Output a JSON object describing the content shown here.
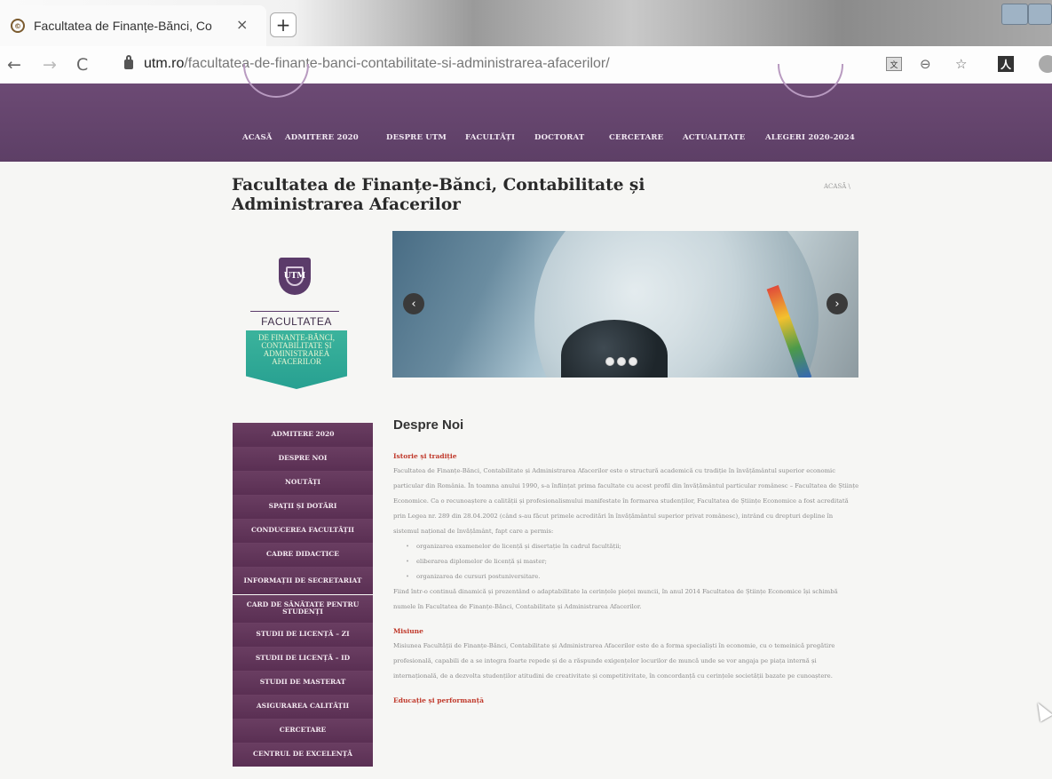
{
  "browser": {
    "tab_title": "Facultatea de Finanțe-Bănci, Co",
    "tab_favicon": "©",
    "url_domain": "utm.ro",
    "url_path": "/facultatea-de-finante-banci-contabilitate-si-administrarea-afacerilor/",
    "icons": {
      "back": "←",
      "forward": "→",
      "reload": "C",
      "zoom": "⊖",
      "star": "☆",
      "pdf": "人",
      "translate": "文",
      "close": "×",
      "newtab": "+"
    }
  },
  "main_nav": {
    "items": [
      "ACASĂ",
      "ADMITERE 2020",
      "DESPRE UTM",
      "FACULTĂȚI",
      "DOCTORAT",
      "CERCETARE",
      "ACTUALITATE",
      "ALEGERI 2020-2024"
    ]
  },
  "page": {
    "title": "Facultatea de Finanțe-Bănci, Contabilitate și Administrarea Afacerilor",
    "breadcrumb": "ACASĂ \\"
  },
  "logo": {
    "monogram": "UTM",
    "word": "FACULTATEA",
    "badge": "DE FINANȚE-BĂNCI, CONTABILITATE ȘI ADMINISTRAREA AFACERILOR"
  },
  "slider": {
    "prev": "‹",
    "next": "›",
    "dots": 3
  },
  "sidebar": {
    "items": [
      "ADMITERE 2020",
      "DESPRE NOI",
      "NOUTĂȚI",
      "SPAȚII ȘI DOTĂRI",
      "CONDUCEREA FACULTĂȚII",
      "CADRE DIDACTICE",
      "INFORMAȚII DE SECRETARIAT",
      "CARD DE SĂNĂTATE PENTRU STUDENȚI",
      "STUDII DE LICENȚĂ – ZI",
      "STUDII DE LICENȚĂ – ID",
      "STUDII DE MASTERAT",
      "ASIGURAREA CALITĂȚII",
      "CERCETARE",
      "CENTRUL DE EXCELENȚĂ"
    ]
  },
  "content": {
    "heading": "Despre Noi",
    "sections": [
      {
        "title": "Istorie și tradiție",
        "text": "Facultatea de Finanțe-Bănci, Contabilitate și Administrarea Afacerilor este o structură academică cu tradiție în învățământul superior economic particular din România. În toamna anului 1990, s-a înființat prima facultate cu acest profil din învățământul particular românesc – Facultatea de Științe Economice. Ca o recunoaștere a calității și profesionalismului manifestate în formarea studenților, Facultatea de Științe Economice a fost acreditată prin Legea nr. 289 din 28.04.2002 (când s-au făcut primele acreditări în învățământul superior privat românesc), intrând cu drepturi depline în sistemul național de învățământ, fapt care a permis:",
        "bullets": [
          "organizarea examenelor de licență și disertație în cadrul facultății;",
          "eliberarea diplomelor de licență și master;",
          "organizarea de cursuri postuniversitare."
        ],
        "text2": "Fiind într-o continuă dinamică și prezentând o adaptabilitate la cerințele pieței muncii, în anul 2014 Facultatea de Științe Economice își schimbă numele în Facultatea de Finanțe-Bănci, Contabilitate și Administrarea Afacerilor."
      },
      {
        "title": "Misiune",
        "text": "Misiunea Facultății de Finanțe-Bănci, Contabilitate și Administrarea Afacerilor este de a forma specialiști în economie, cu o temeinică pregătire profesională, capabili de a se integra foarte repede și de a răspunde exigențelor locurilor de muncă unde se vor angaja pe piața internă și internațională, de a dezvolta studenților atitudini de creativitate și competitivitate, în concordanță cu cerințele societății bazate pe cunoaștere."
      },
      {
        "title": "Educație și performanță"
      }
    ]
  }
}
